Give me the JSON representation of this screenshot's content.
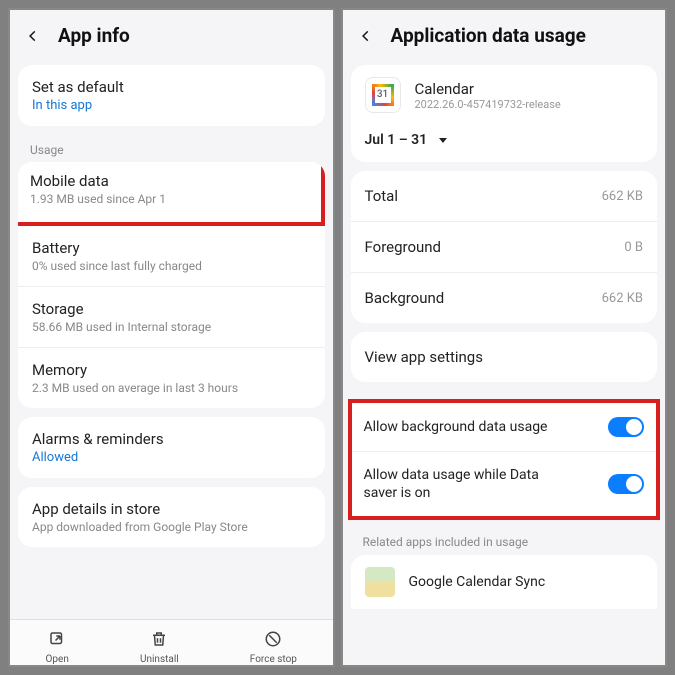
{
  "left": {
    "title": "App info",
    "setDefault": {
      "title": "Set as default",
      "sub": "In this app"
    },
    "usageLabel": "Usage",
    "mobileData": {
      "title": "Mobile data",
      "sub": "1.93 MB used since Apr 1"
    },
    "battery": {
      "title": "Battery",
      "sub": "0% used since last fully charged"
    },
    "storage": {
      "title": "Storage",
      "sub": "58.66 MB used in Internal storage"
    },
    "memory": {
      "title": "Memory",
      "sub": "2.3 MB used on average in last 3 hours"
    },
    "alarms": {
      "title": "Alarms & reminders",
      "sub": "Allowed"
    },
    "details": {
      "title": "App details in store",
      "sub": "App downloaded from Google Play Store"
    },
    "bottom": {
      "open": "Open",
      "uninstall": "Uninstall",
      "forceStop": "Force stop"
    }
  },
  "right": {
    "title": "Application data usage",
    "appName": "Calendar",
    "appVersion": "2022.26.0-457419732-release",
    "dateRange": "Jul 1 – 31",
    "total": {
      "label": "Total",
      "value": "662 KB"
    },
    "foreground": {
      "label": "Foreground",
      "value": "0 B"
    },
    "background": {
      "label": "Background",
      "value": "662 KB"
    },
    "viewSettings": "View app settings",
    "allowBg": "Allow background data usage",
    "allowDataSaver": "Allow data usage while Data saver is on",
    "relatedLabel": "Related apps included in usage",
    "relatedApp": "Google Calendar Sync"
  }
}
